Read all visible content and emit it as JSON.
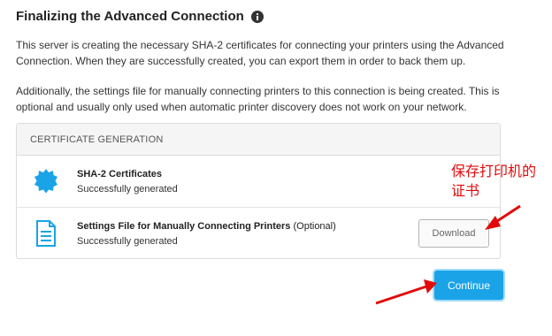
{
  "header": {
    "title": "Finalizing the Advanced Connection",
    "info_icon": "info-circle-icon"
  },
  "intro": {
    "paragraph1": "This server is creating the necessary SHA-2 certificates for connecting your printers using the Advanced Connection. When they are successfully created, you can export them in order to back them up.",
    "paragraph2": "Additionally, the settings file for manually connecting printers to this connection is being created. This is optional and usually only used when automatic printer discovery does not work on your network."
  },
  "card": {
    "header": "CERTIFICATE GENERATION",
    "items": [
      {
        "icon": "certificate-badge-icon",
        "title": "SHA-2 Certificates",
        "optional": "",
        "status": "Successfully generated"
      },
      {
        "icon": "document-icon",
        "title": "Settings File for Manually Connecting Printers",
        "optional": " (Optional)",
        "status": "Successfully generated",
        "button": "Download"
      }
    ]
  },
  "actions": {
    "continue_label": "Continue"
  },
  "annotation": {
    "text": "保存打印机的证书",
    "color": "#e10b0b"
  },
  "colors": {
    "accent": "#1ba3e8",
    "annotation": "#e10b0b"
  }
}
